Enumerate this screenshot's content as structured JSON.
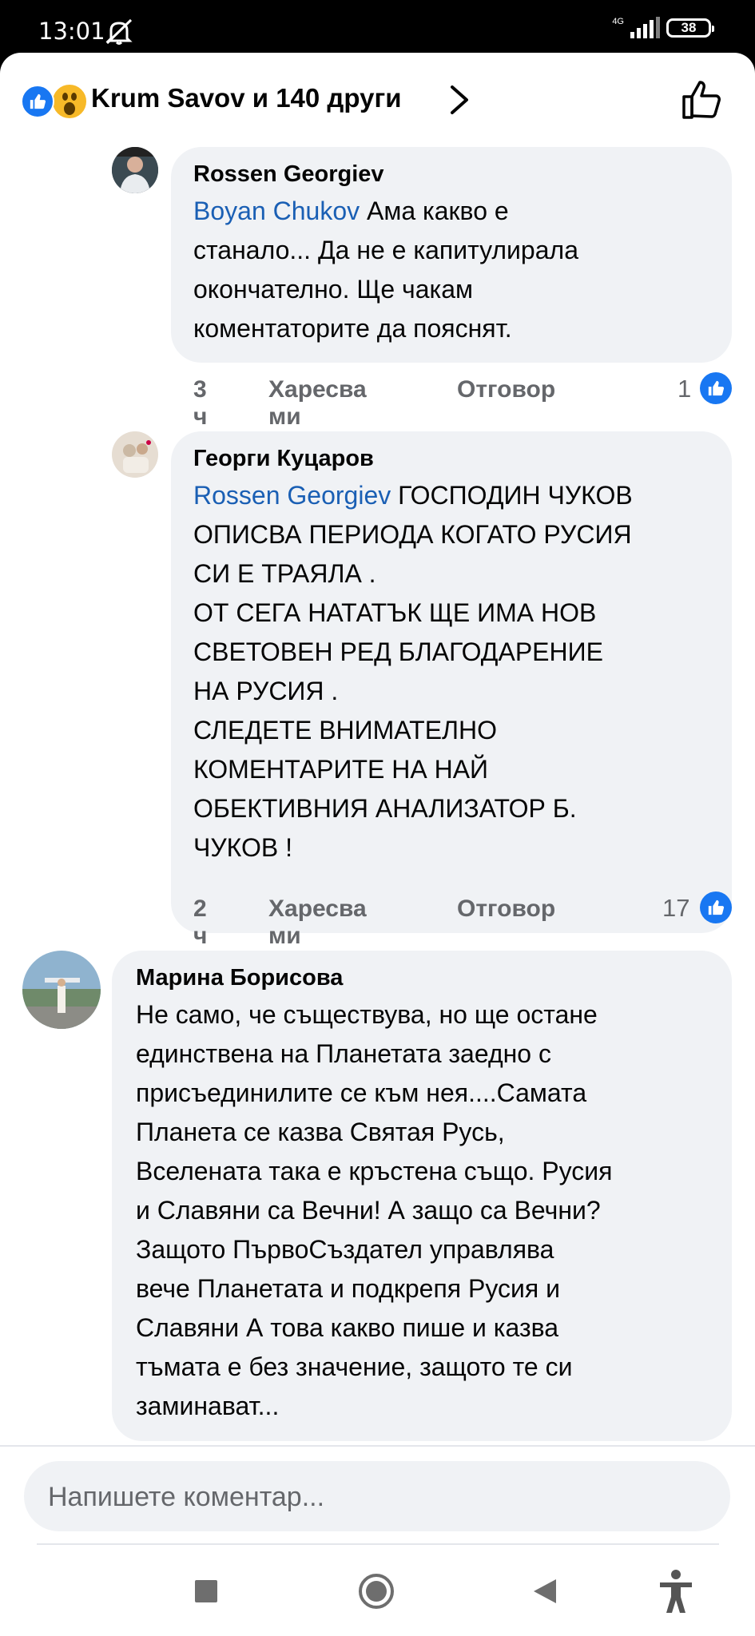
{
  "status_bar": {
    "time": "13:01",
    "network": "4G",
    "battery": "38"
  },
  "header": {
    "title": "Krum Savov и 140 други"
  },
  "comments": [
    {
      "author": "Rossen Georgiev",
      "mention": "Boyan Chukov",
      "lines": [
        " Ама какво е",
        "станало... Да не е капитулирала",
        "окончателно. Ще чакам",
        "коментаторите да пояснят."
      ],
      "age": "3 ч",
      "like_label": "Харесва ми",
      "reply_label": "Отговор",
      "like_count": "1"
    },
    {
      "author": "Георги Куцаров",
      "mention": "Rossen Georgiev",
      "lines": [
        " ГОСПОДИН ЧУКОВ",
        "ОПИСВА ПЕРИОДА КОГАТО РУСИЯ",
        "СИ Е ТРАЯЛА .",
        "ОТ СЕГА НАТАТЪК ЩЕ ИМА НОВ",
        "СВЕТОВЕН РЕД БЛАГОДАРЕНИЕ",
        "НА РУСИЯ .",
        "СЛЕДЕТЕ ВНИМАТЕЛНО",
        "КОМЕНТАРИТЕ НА НАЙ",
        "ОБЕКТИВНИЯ АНАЛИЗАТОР Б.",
        "ЧУКОВ !"
      ],
      "age": "2 ч",
      "like_label": "Харесва ми",
      "reply_label": "Отговор",
      "like_count": "17"
    },
    {
      "author": "Марина Борисова",
      "lines": [
        "Не само, че съществува, но ще остане",
        "единствена на Планетата заедно с",
        "присъединилите се към нея....Самата",
        "Планета се казва Святая Русь,",
        "Вселената така е кръстена също. Русия",
        "и Славяни са Вечни! А защо са Вечни?",
        "Защото ПървоСъздател управлява",
        "вече Планетата и  подкрепя Русия и",
        "Славяни А това какво пише и казва",
        "тъмата е без значение, защото те си",
        "заминават..."
      ]
    }
  ],
  "composer": {
    "placeholder": "Напишете коментар..."
  },
  "icons": {
    "mute": "mute-icon",
    "reactions": [
      "like-reaction-icon",
      "wow-reaction-icon"
    ],
    "chevron": "chevron-right-icon",
    "like_outline": "thumbs-up-outline-icon",
    "nav": [
      "recents-square-icon",
      "home-circle-icon",
      "back-triangle-icon",
      "accessibility-icon"
    ]
  },
  "colors": {
    "facebook_blue": "#1877f2",
    "mention_blue": "#1a5fb4",
    "bubble_bg": "#f0f2f5",
    "meta_gray": "#65676b"
  }
}
